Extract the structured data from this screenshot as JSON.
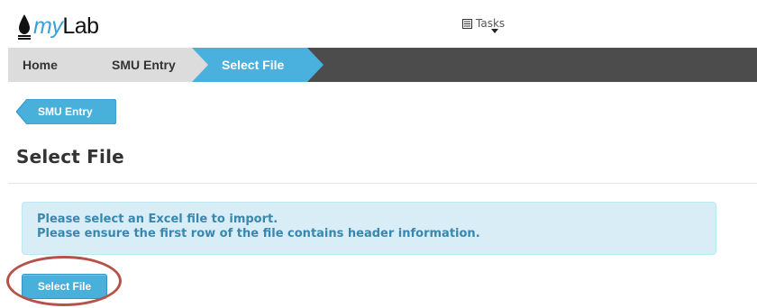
{
  "app": {
    "logo_prefix": "my",
    "logo_suffix": "Lab",
    "brand_color": "#3a9fd6"
  },
  "nav": {
    "tasks_label": "Tasks",
    "tasks_icon": "list-icon"
  },
  "breadcrumb": {
    "items": [
      {
        "label": "Home",
        "state": "default"
      },
      {
        "label": "SMU Entry",
        "state": "default"
      },
      {
        "label": "Select File",
        "state": "active"
      }
    ],
    "active_color": "#4ab0de"
  },
  "back_button": {
    "label": "SMU Entry"
  },
  "page": {
    "title": "Select File"
  },
  "alert": {
    "line1": "Please select an Excel file to import.",
    "line2": "Please ensure the first row of the file contains header information."
  },
  "actions": {
    "select_file_label": "Select File"
  },
  "annotation": {
    "highlight_color": "#b5524a",
    "target": "select-file-button"
  }
}
